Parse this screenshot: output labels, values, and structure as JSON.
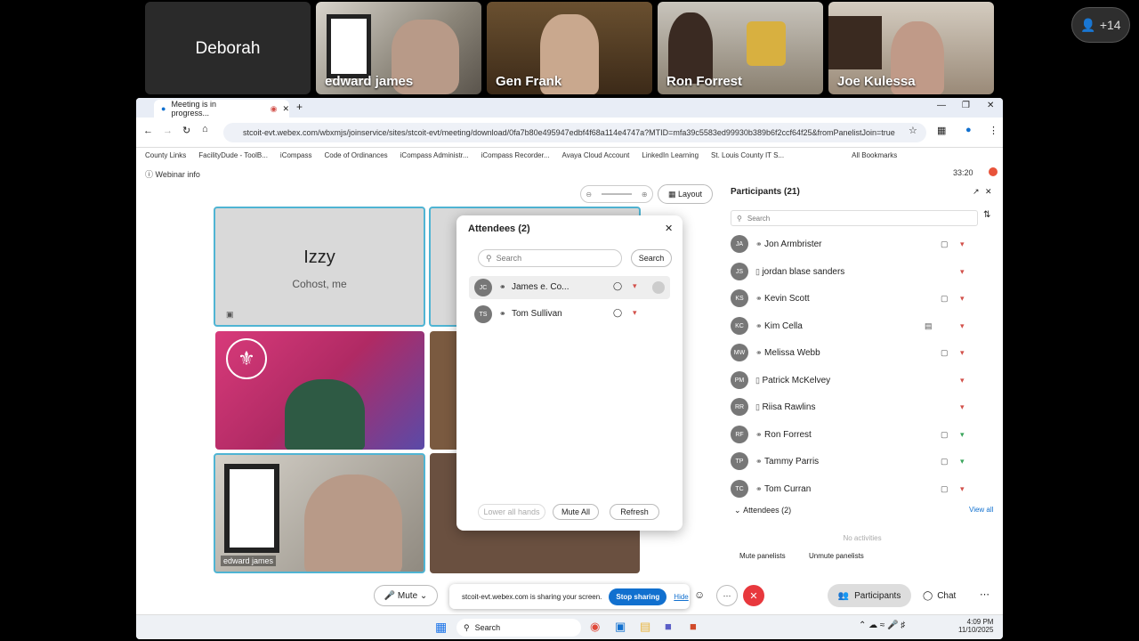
{
  "top_tiles": [
    "Deborah",
    "edward james",
    "Gen Frank",
    "Ron Forrest",
    "Joe Kulessa"
  ],
  "overflow_count": "+14",
  "browser": {
    "tab_title": "Meeting is in progress...",
    "url": "stcoit-evt.webex.com/wbxmjs/joinservice/sites/stcoit-evt/meeting/download/0fa7b80e495947edbf4f68a114e4747a?MTID=mfa39c5583ed99930b389b6f2ccf64f25&fromPanelistJoin=true",
    "bookmarks": [
      "County Links",
      "FacilityDude - ToolB...",
      "iCompass",
      "Code of Ordinances",
      "iCompass Administr...",
      "iCompass Recorder...",
      "Avaya Cloud Account",
      "LinkedIn Learning",
      "St. Louis County IT S..."
    ],
    "all_bookmarks": "All Bookmarks"
  },
  "meeting": {
    "webinar_info": "Webinar info",
    "timer": "33:20",
    "layout_label": "Layout",
    "izzy_name": "Izzy",
    "izzy_role": "Cohost, me",
    "edward_label": "edward james"
  },
  "attendees_dialog": {
    "title": "Attendees (2)",
    "search_placeholder": "Search",
    "search_button": "Search",
    "rows": [
      {
        "initials": "JC",
        "name": "James e. Co..."
      },
      {
        "initials": "TS",
        "name": "Tom Sullivan"
      }
    ],
    "lower_all_hands": "Lower all hands",
    "mute_all": "Mute All",
    "refresh": "Refresh"
  },
  "participants_panel": {
    "title": "Participants (21)",
    "search_placeholder": "Search",
    "rows": [
      {
        "initials": "JA",
        "name": "Jon Armbrister"
      },
      {
        "initials": "JS",
        "name": "jordan blase sanders"
      },
      {
        "initials": "KS",
        "name": "Kevin Scott"
      },
      {
        "initials": "KC",
        "name": "Kim Cella"
      },
      {
        "initials": "MW",
        "name": "Melissa Webb"
      },
      {
        "initials": "PM",
        "name": "Patrick McKelvey"
      },
      {
        "initials": "RR",
        "name": "Riisa Rawlins"
      },
      {
        "initials": "RF",
        "name": "Ron Forrest"
      },
      {
        "initials": "TP",
        "name": "Tammy Parris"
      },
      {
        "initials": "TC",
        "name": "Tom Curran"
      }
    ],
    "attendees_section": "Attendees (2)",
    "view_all": "View all",
    "no_activities": "No activities",
    "mute_panelists": "Mute panelists",
    "unmute_panelists": "Unmute panelists"
  },
  "controls": {
    "mute": "Mute",
    "sharing_text": "stcoit-evt.webex.com is sharing your screen.",
    "stop_sharing": "Stop sharing",
    "hide": "Hide",
    "participants": "Participants",
    "chat": "Chat"
  },
  "taskbar": {
    "search": "Search",
    "time": "4:09 PM",
    "date": "11/10/2025"
  },
  "colors": {
    "accent": "#1170cf",
    "end_red": "#e8383d",
    "selected_border": "#4fb4d3"
  }
}
